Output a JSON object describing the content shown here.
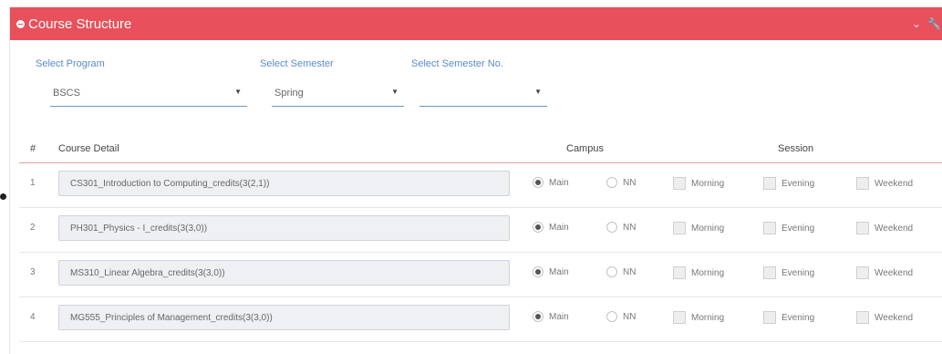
{
  "panel": {
    "title": "Course Structure"
  },
  "filters": {
    "program": {
      "label": "Select Program",
      "value": "BSCS"
    },
    "semester": {
      "label": "Select Semester",
      "value": "Spring"
    },
    "semester_no": {
      "label": "Select Semester No.",
      "value": ""
    }
  },
  "table": {
    "headers": {
      "index": "#",
      "course": "Course Detail",
      "campus": "Campus",
      "session": "Session"
    },
    "rows": [
      {
        "num": "1",
        "course": "CS301_Introduction to Computing_credits(3(2,1))",
        "campus": "Main",
        "main": "Main",
        "nn": "NN",
        "morning": "Morning",
        "evening": "Evening",
        "weekend": "Weekend"
      },
      {
        "num": "2",
        "course": "PH301_Physics - I_credits(3(3,0))",
        "campus": "Main",
        "main": "Main",
        "nn": "NN",
        "morning": "Morning",
        "evening": "Evening",
        "weekend": "Weekend"
      },
      {
        "num": "3",
        "course": "MS310_Linear Algebra_credits(3(3,0))",
        "campus": "Main",
        "main": "Main",
        "nn": "NN",
        "morning": "Morning",
        "evening": "Evening",
        "weekend": "Weekend"
      },
      {
        "num": "4",
        "course": "MG555_Principles of Management_credits(3(3,0))",
        "campus": "Main",
        "main": "Main",
        "nn": "NN",
        "morning": "Morning",
        "evening": "Evening",
        "weekend": "Weekend"
      }
    ]
  },
  "icons": [
    "minus-circle-icon",
    "chevron-down-icon",
    "wrench-icon",
    "refresh-icon",
    "caret-down-icon",
    "bullet-icon"
  ],
  "colors": {
    "header": "#e8505b",
    "label": "#5a8bc8"
  }
}
